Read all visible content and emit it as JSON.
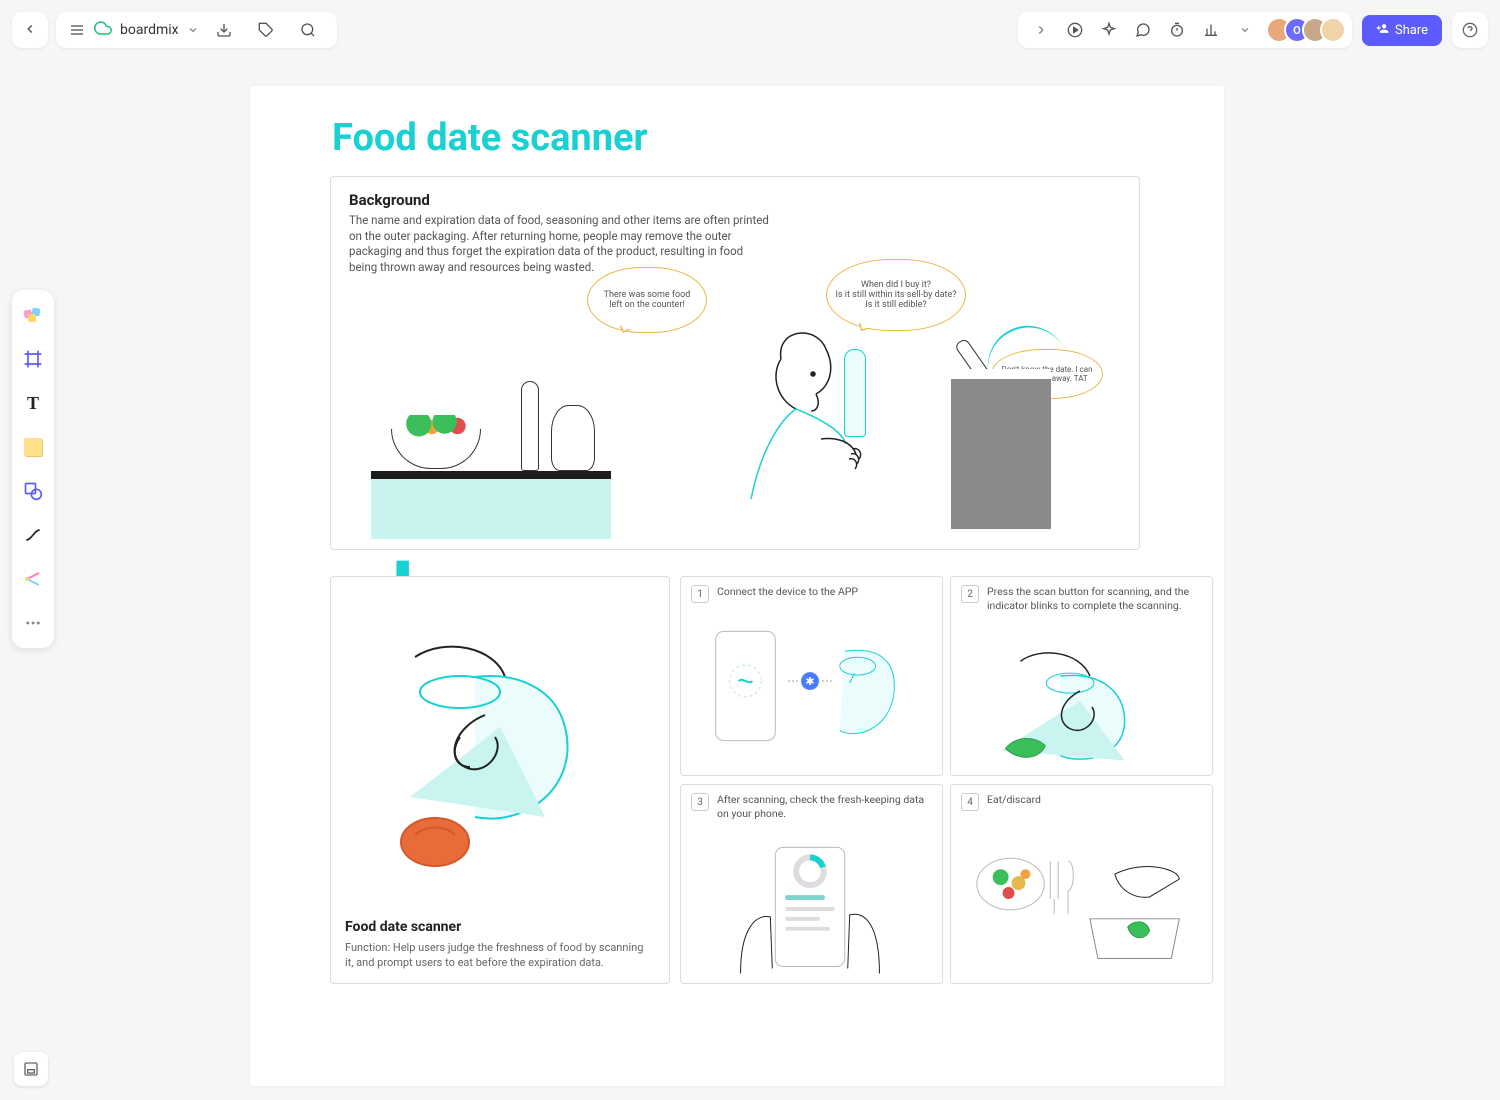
{
  "app": {
    "name": "boardmix"
  },
  "topRight": {
    "share": "Share",
    "avatarLabel": "O"
  },
  "doc": {
    "title": "Food date scanner",
    "background": {
      "heading": "Background",
      "body": "The name and expiration data of food, seasoning and other items are often printed on the outer packaging. After returning home, people may remove the outer packaging and thus forget the expiration data of the product, resulting in food being thrown away and resources being wasted."
    },
    "bubbles": {
      "b1": "There was some food left on the counter!",
      "b2": "When did I buy it?\nIs it still within its sell-by date?\nIs it still edible?",
      "b3": "Don't know the date. I can only throw it away. TAT"
    },
    "scanPanel": {
      "heading": "Food date scanner",
      "body": "Function: Help users judge the freshness of food by scanning it, and prompt users to eat before the expiration data."
    },
    "steps": {
      "s1": {
        "num": "1",
        "text": "Connect the device to the APP"
      },
      "s2": {
        "num": "2",
        "text": "Press the scan button for scanning, and the indicator blinks to complete the scanning."
      },
      "s3": {
        "num": "3",
        "text": "After scanning, check the fresh-keeping data on your phone."
      },
      "s4": {
        "num": "4",
        "text": "Eat/discard"
      }
    }
  }
}
